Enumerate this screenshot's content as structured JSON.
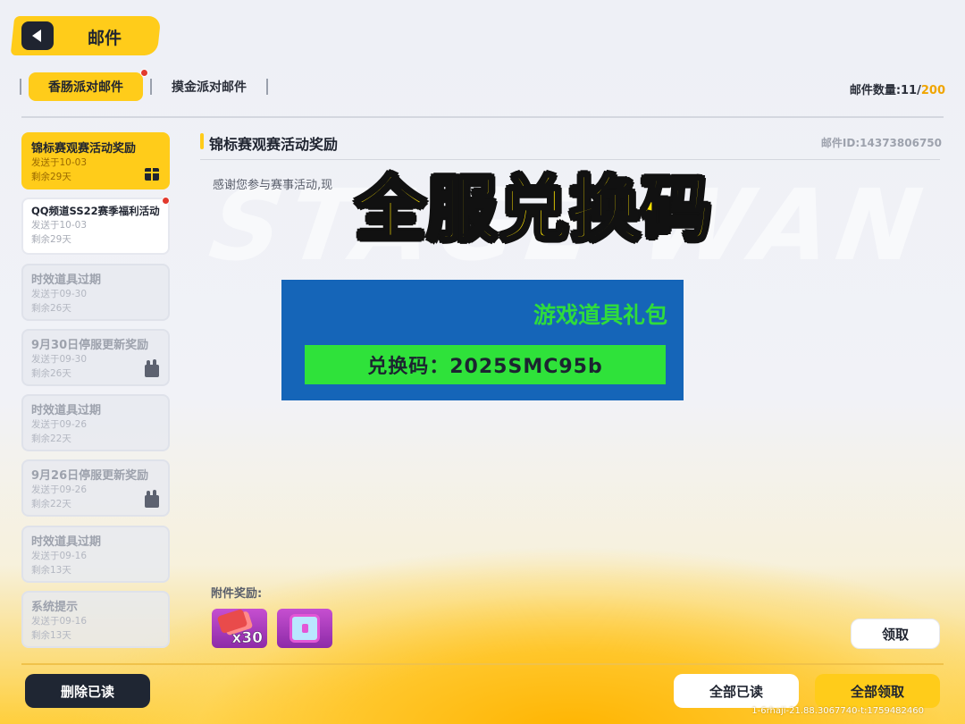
{
  "header": {
    "title": "邮件",
    "back_icon": "back-arrow-icon"
  },
  "tabs": [
    {
      "label": "香肠派对邮件",
      "active": true,
      "has_dot": true
    },
    {
      "label": "摸金派对邮件",
      "active": false
    }
  ],
  "mail_count": {
    "label": "邮件数量:",
    "current": "11",
    "sep": "/",
    "max": "200"
  },
  "mail_list": [
    {
      "title": "锦标赛观赛活动奖励",
      "sent": "发送于10-03",
      "remaining": "剩余29天",
      "state": "active",
      "icon": "gift-icon"
    },
    {
      "title": "QQ频道SS22赛季福利活动",
      "sent": "发送于10-03",
      "remaining": "剩余29天",
      "state": "unread",
      "has_dot": true
    },
    {
      "title": "时效道具过期",
      "sent": "发送于09-30",
      "remaining": "剩余26天",
      "state": "read"
    },
    {
      "title": "9月30日停服更新奖励",
      "sent": "发送于09-30",
      "remaining": "剩余26天",
      "state": "read",
      "icon": "claimed-icon"
    },
    {
      "title": "时效道具过期",
      "sent": "发送于09-26",
      "remaining": "剩余22天",
      "state": "read"
    },
    {
      "title": "9月26日停服更新奖励",
      "sent": "发送于09-26",
      "remaining": "剩余22天",
      "state": "read",
      "icon": "claimed-icon"
    },
    {
      "title": "时效道具过期",
      "sent": "发送于09-16",
      "remaining": "剩余13天",
      "state": "read"
    },
    {
      "title": "系统提示",
      "sent": "发送于09-16",
      "remaining": "剩余13天",
      "state": "read"
    }
  ],
  "content": {
    "title": "锦标赛观赛活动奖励",
    "mail_id": "邮件ID:14373806750",
    "body": "感谢您参与赛事活动,现"
  },
  "watermark": "STAGE WAN",
  "overlay": {
    "title": "全服兑换码"
  },
  "code_card": {
    "title": "游戏道具礼包",
    "code": "兑换码：2025SMC95b"
  },
  "attachments": {
    "label": "附件奖励:",
    "items": [
      {
        "icon": "chip-bundle-icon",
        "qty": "x30"
      },
      {
        "icon": "treasure-chest-icon",
        "qty": ""
      }
    ]
  },
  "buttons": {
    "claim": "领取",
    "delete_read": "删除已读",
    "read_all": "全部已读",
    "claim_all": "全部领取"
  },
  "footer_meta": "1-6rhaji-21.88.3067740-t:1759482460",
  "colors": {
    "accent": "#ffcc1a",
    "dark": "#1f2430",
    "dot": "#e23a2e",
    "card_blue": "#1565b8",
    "code_green": "#2fe23a"
  }
}
